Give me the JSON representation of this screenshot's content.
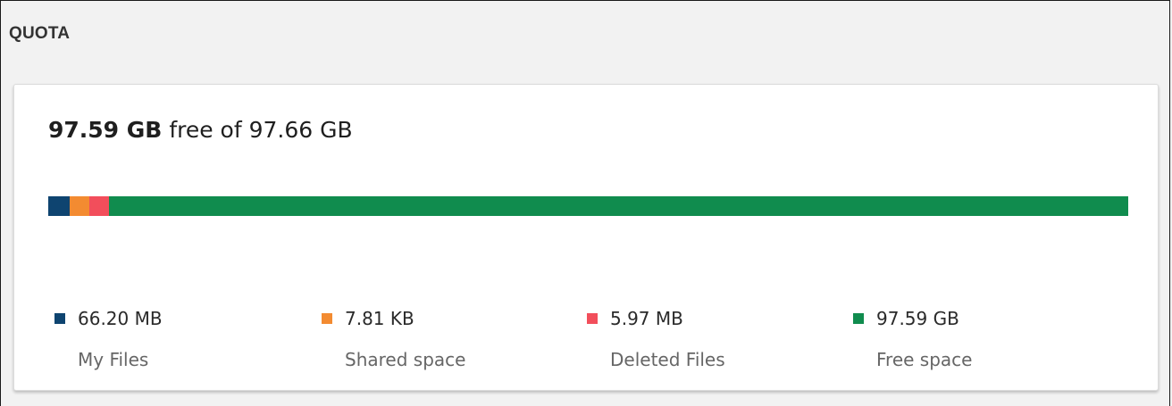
{
  "section": {
    "title": "QUOTA"
  },
  "quota": {
    "free": "97.59 GB",
    "free_of_text": "free of",
    "total": "97.66 GB"
  },
  "colors": {
    "my_files": "#0e4470",
    "shared_space": "#f38b31",
    "deleted_files": "#f24e5b",
    "free_space": "#108c4e"
  },
  "usage_bar": {
    "segments": [
      {
        "key": "my_files",
        "fraction": 0.0195,
        "color": "#0e4470"
      },
      {
        "key": "shared_space",
        "fraction": 0.0185,
        "color": "#f38b31"
      },
      {
        "key": "deleted_files",
        "fraction": 0.0185,
        "color": "#f24e5b"
      },
      {
        "key": "free_space",
        "fraction": 0.9435,
        "color": "#108c4e"
      }
    ]
  },
  "legend": {
    "items": [
      {
        "value": "66.20 MB",
        "label": "My Files",
        "color": "#0e4470"
      },
      {
        "value": "7.81 KB",
        "label": "Shared space",
        "color": "#f38b31"
      },
      {
        "value": "5.97 MB",
        "label": "Deleted Files",
        "color": "#f24e5b"
      },
      {
        "value": "97.59 GB",
        "label": "Free space",
        "color": "#108c4e"
      }
    ]
  }
}
